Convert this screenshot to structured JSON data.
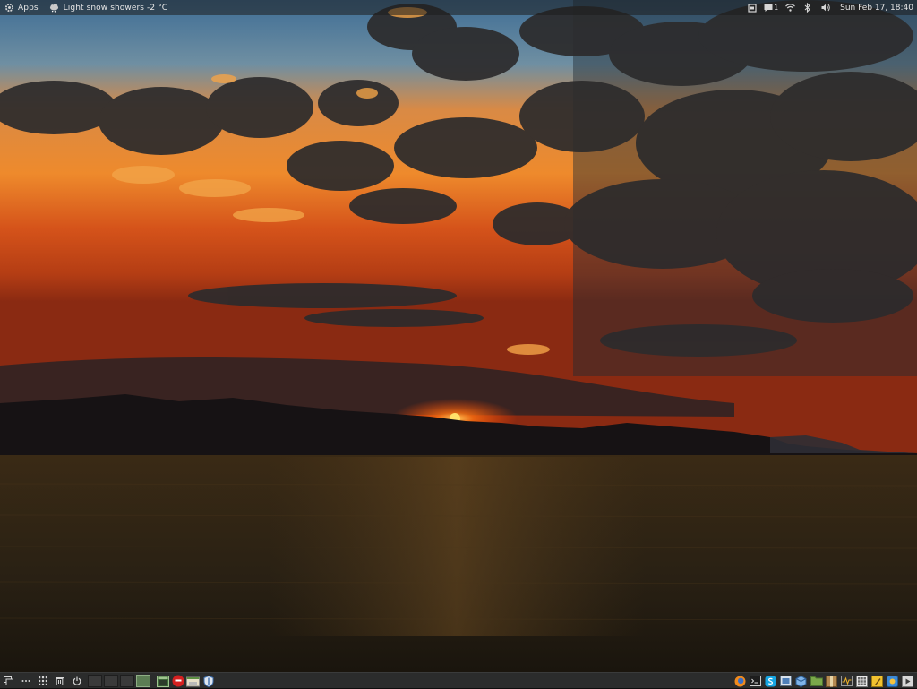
{
  "top_panel": {
    "apps_label": "Apps",
    "weather_text": "Light snow showers -2 °C",
    "notification_count": "1",
    "clock": "Sun Feb 17, 18:40"
  },
  "icons": {
    "apps": "gear-icon",
    "weather": "cloud-snow-icon",
    "tray": [
      "clipboard-icon",
      "message-icon",
      "network-icon",
      "bluetooth-icon",
      "volume-icon"
    ],
    "bottom_left": [
      "show-desktop-icon",
      "dots-menu-icon",
      "app-grid-icon",
      "trash-icon",
      "power-icon"
    ],
    "taskbar": [
      "terminal-window-icon",
      "red-app-icon",
      "file-manager-icon",
      "shield-icon"
    ],
    "tray_bottom": [
      "firefox-icon",
      "terminal-icon",
      "skype-icon",
      "screenshot-icon",
      "cube-icon",
      "folder-icon",
      "archive-icon",
      "system-monitor-icon",
      "calculator-icon",
      "notes-icon",
      "hexchat-icon",
      "media-player-icon"
    ]
  },
  "workspaces": {
    "count": 4,
    "active_index": 3
  },
  "colors": {
    "panel_bg": "#2b2c2c",
    "workspace_active": "#5c7d54",
    "sun": "#ff6a00"
  }
}
